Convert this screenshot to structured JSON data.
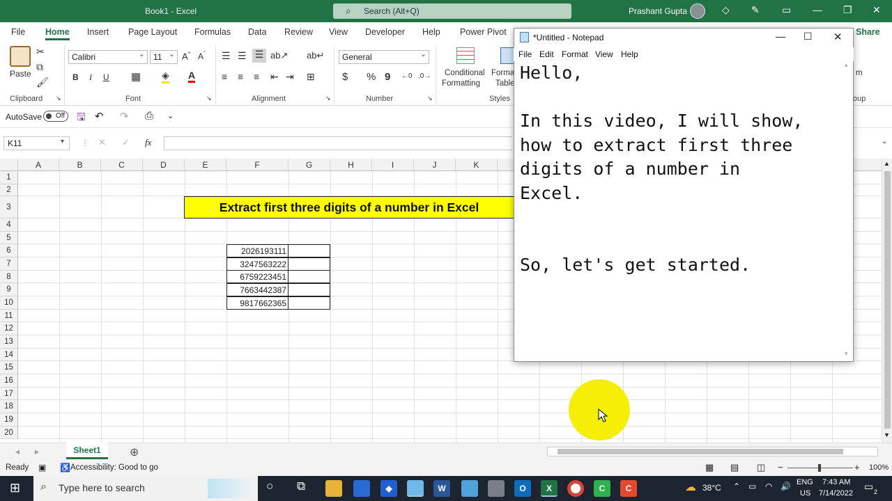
{
  "title_bar": {
    "title": "Book1 - Excel",
    "search_placeholder": "Search (Alt+Q)",
    "user": "Prashant Gupta"
  },
  "ribbon_tabs": [
    "File",
    "Home",
    "Insert",
    "Page Layout",
    "Formulas",
    "Data",
    "Review",
    "View",
    "Developer",
    "Help",
    "Power Pivot"
  ],
  "share_label": "Share",
  "ribbon": {
    "clipboard": {
      "paste": "Paste",
      "label": "Clipboard"
    },
    "font": {
      "name": "Calibri",
      "size": "11",
      "label": "Font",
      "bold": "B",
      "italic": "I",
      "underline": "U"
    },
    "alignment": {
      "label": "Alignment"
    },
    "number": {
      "format": "General",
      "label": "Number",
      "currency": "$",
      "percent": "%",
      "comma": "9"
    },
    "styles": {
      "conditional": "Conditional",
      "formatting": "Formatting",
      "format_as": "Forma",
      "table": "Table",
      "label": "Styles"
    },
    "partial_right": {
      "m": "m",
      "oup": "oup"
    }
  },
  "qat": {
    "autosave": "AutoSave",
    "toggle": "Off"
  },
  "formula_bar": {
    "name_box": "K11",
    "fx": "fx"
  },
  "columns": [
    "A",
    "B",
    "C",
    "D",
    "E",
    "F",
    "G",
    "H",
    "I",
    "J",
    "K"
  ],
  "rows": [
    "1",
    "2",
    "3",
    "4",
    "5",
    "6",
    "7",
    "8",
    "9",
    "10",
    "11",
    "12",
    "13",
    "14",
    "15",
    "16",
    "17",
    "18",
    "19",
    "20"
  ],
  "banner_text": "Extract first three digits of a number in Excel",
  "numbers": [
    "2026193111",
    "3247563222",
    "6759223451",
    "7663442387",
    "9817662365"
  ],
  "sheet_tab": "Sheet1",
  "status": {
    "ready": "Ready",
    "accessibility": "Accessibility: Good to go",
    "zoom": "100%"
  },
  "notepad": {
    "title": "*Untitled - Notepad",
    "menu": [
      "File",
      "Edit",
      "Format",
      "View",
      "Help"
    ],
    "text": "Hello,\n\nIn this video, I will show,\nhow to extract first three\ndigits of a number in\nExcel.\n\n\nSo, let's get started."
  },
  "taskbar": {
    "search_placeholder": "Type here to search",
    "temperature": "38°C",
    "lang1": "ENG",
    "lang2": "US",
    "time": "7:43 AM",
    "date": "7/14/2022",
    "notif": "2"
  },
  "colors": {
    "excel_green": "#217346",
    "banner_yellow": "#ffff00",
    "cursor_highlight": "#f5ee07",
    "taskbar": "#1c2430"
  }
}
